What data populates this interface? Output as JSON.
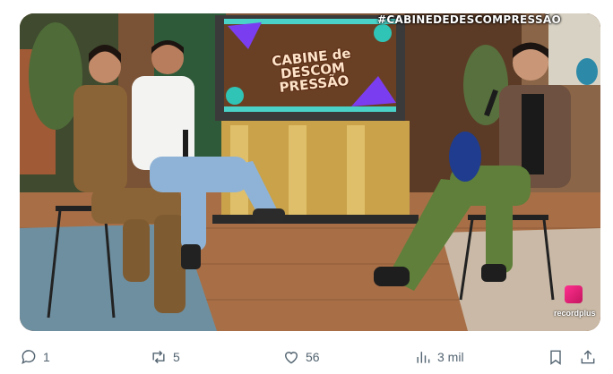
{
  "media": {
    "hashtag": "#CABINEDEDESCOMPRESSÃO",
    "screen_title": "CABINE de DESCOM PRESSÃO",
    "channel_logo": "recordplus"
  },
  "actions": {
    "reply_count": "1",
    "retweet_count": "5",
    "like_count": "56",
    "views_count": "3 mil"
  }
}
